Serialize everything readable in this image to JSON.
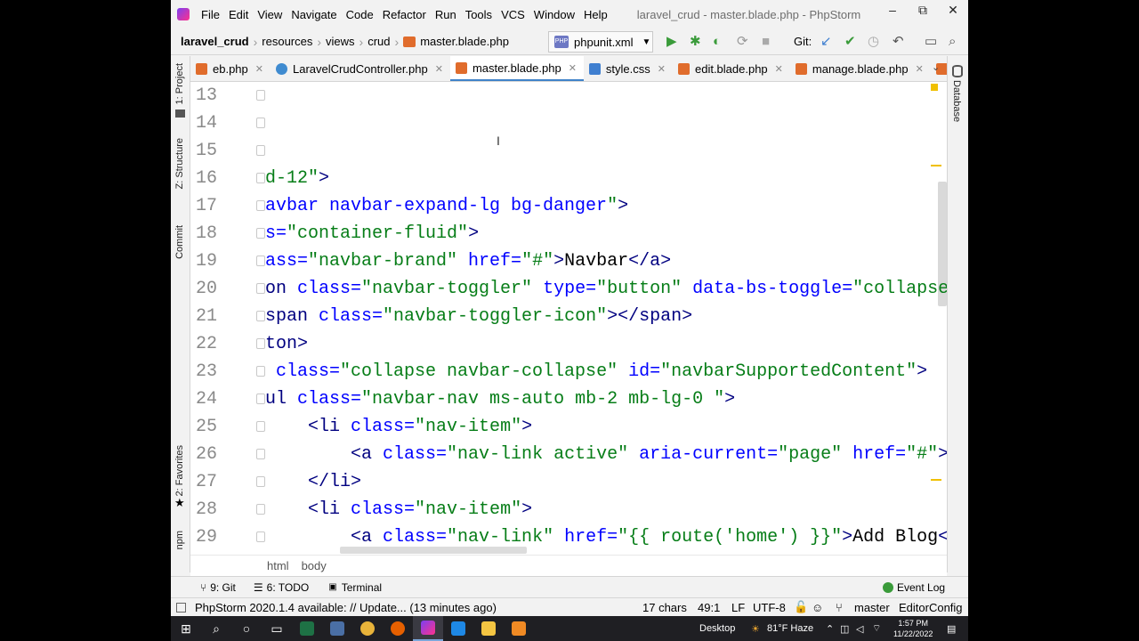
{
  "window": {
    "title": "laravel_crud - master.blade.php - PhpStorm",
    "menu": [
      "File",
      "Edit",
      "View",
      "Navigate",
      "Code",
      "Refactor",
      "Run",
      "Tools",
      "VCS",
      "Window",
      "Help"
    ],
    "controls": {
      "minimize": "–",
      "maximize": "⧉",
      "close": "✕"
    }
  },
  "breadcrumb": {
    "project": "laravel_crud",
    "items": [
      "resources",
      "views",
      "crud"
    ],
    "file": "master.blade.php"
  },
  "toolbar": {
    "run_config": "phpunit.xml",
    "git_label": "Git:"
  },
  "tabs": [
    {
      "label": "eb.php",
      "icon": "blade-file-icon",
      "active": false
    },
    {
      "label": "LaravelCrudController.php",
      "icon": "class-icon",
      "active": false
    },
    {
      "label": "master.blade.php",
      "icon": "blade-file-icon",
      "active": true
    },
    {
      "label": "style.css",
      "icon": "css-file-icon",
      "active": false
    },
    {
      "label": "edit.blade.php",
      "icon": "blade-file-icon",
      "active": false
    },
    {
      "label": "manage.blade.php",
      "icon": "blade-file-icon",
      "active": false
    },
    {
      "label": "a",
      "icon": "blade-file-icon",
      "active": false
    }
  ],
  "left_tools": [
    "1: Project",
    "Z: Structure",
    "Commit",
    "2: Favorites",
    "npm"
  ],
  "right_tools": [
    "Database"
  ],
  "editor": {
    "lines": [
      {
        "n": "13",
        "segs": []
      },
      {
        "n": "14",
        "segs": []
      },
      {
        "n": "15",
        "segs": []
      },
      {
        "n": "16",
        "segs": [
          [
            "str",
            "d-12\""
          ],
          [
            "tag",
            ">"
          ]
        ]
      },
      {
        "n": "17",
        "segs": [
          [
            "attr",
            "avbar navbar-expand-lg bg-danger"
          ],
          [
            "str",
            "\""
          ],
          [
            "tag",
            ">"
          ]
        ]
      },
      {
        "n": "18",
        "segs": [
          [
            "attr",
            "s="
          ],
          [
            "str",
            "\"container-fluid\""
          ],
          [
            "tag",
            ">"
          ]
        ]
      },
      {
        "n": "19",
        "segs": [
          [
            "attr",
            "ass="
          ],
          [
            "str",
            "\"navbar-brand\""
          ],
          [
            "attr",
            " href="
          ],
          [
            "str",
            "\"#\""
          ],
          [
            "tag",
            ">"
          ],
          [
            "txt",
            "Navbar"
          ],
          [
            "tag",
            "</a>"
          ]
        ]
      },
      {
        "n": "20",
        "segs": [
          [
            "tag",
            "on "
          ],
          [
            "attr",
            "class="
          ],
          [
            "str",
            "\"navbar-toggler\""
          ],
          [
            "attr",
            " type="
          ],
          [
            "str",
            "\"button\""
          ],
          [
            "attr",
            " data-bs-toggle="
          ],
          [
            "str",
            "\"collapse"
          ]
        ]
      },
      {
        "n": "21",
        "segs": [
          [
            "tag",
            "span "
          ],
          [
            "attr",
            "class="
          ],
          [
            "str",
            "\"navbar-toggler-icon\""
          ],
          [
            "tag",
            "></span>"
          ]
        ]
      },
      {
        "n": "22",
        "segs": [
          [
            "tag",
            "ton>"
          ]
        ]
      },
      {
        "n": "23",
        "segs": [
          [
            "attr",
            " class="
          ],
          [
            "str",
            "\"collapse navbar-collapse\""
          ],
          [
            "attr",
            " id="
          ],
          [
            "str",
            "\"navbarSupportedContent\""
          ],
          [
            "tag",
            ">"
          ]
        ]
      },
      {
        "n": "24",
        "segs": [
          [
            "tag",
            "ul "
          ],
          [
            "attr",
            "class="
          ],
          [
            "str",
            "\"navbar-nav ms-auto mb-2 mb-lg-0 \""
          ],
          [
            "tag",
            ">"
          ]
        ]
      },
      {
        "n": "25",
        "segs": [
          [
            "txt",
            "    "
          ],
          [
            "tag",
            "<li "
          ],
          [
            "attr",
            "class="
          ],
          [
            "str",
            "\"nav-item\""
          ],
          [
            "tag",
            ">"
          ]
        ]
      },
      {
        "n": "26",
        "segs": [
          [
            "txt",
            "        "
          ],
          [
            "tag",
            "<a "
          ],
          [
            "attr",
            "class="
          ],
          [
            "str",
            "\"nav-link active\""
          ],
          [
            "attr",
            " aria-current="
          ],
          [
            "str",
            "\"page\""
          ],
          [
            "attr",
            " href="
          ],
          [
            "str",
            "\"#\""
          ],
          [
            "tag",
            ">"
          ],
          [
            "txt",
            "H"
          ]
        ]
      },
      {
        "n": "27",
        "segs": [
          [
            "txt",
            "    "
          ],
          [
            "tag",
            "</li>"
          ]
        ]
      },
      {
        "n": "28",
        "segs": [
          [
            "txt",
            "    "
          ],
          [
            "tag",
            "<li "
          ],
          [
            "attr",
            "class="
          ],
          [
            "str",
            "\"nav-item\""
          ],
          [
            "tag",
            ">"
          ]
        ]
      },
      {
        "n": "29",
        "segs": [
          [
            "txt",
            "        "
          ],
          [
            "tag",
            "<a "
          ],
          [
            "attr",
            "class="
          ],
          [
            "str",
            "\"nav-link\""
          ],
          [
            "attr",
            " href="
          ],
          [
            "str",
            "\"{{ route('home') }}\""
          ],
          [
            "tag",
            ">"
          ],
          [
            "txt",
            "Add Blog"
          ],
          [
            "tag",
            "</"
          ]
        ]
      }
    ]
  },
  "code_breadcrumb": [
    "html",
    "body"
  ],
  "tool_windows": [
    "9: Git",
    "6: TODO",
    "Terminal"
  ],
  "event_log": "Event Log",
  "status": {
    "message": "PhpStorm 2020.1.4 available: // Update... (13 minutes ago)",
    "chars": "17 chars",
    "position": "49:1",
    "line_sep": "LF",
    "encoding": "UTF-8",
    "branch": "master",
    "editor_config": "EditorConfig"
  },
  "taskbar": {
    "desktop": "Desktop",
    "weather": "81°F Haze",
    "time": "1:57 PM",
    "date": "11/22/2022"
  }
}
